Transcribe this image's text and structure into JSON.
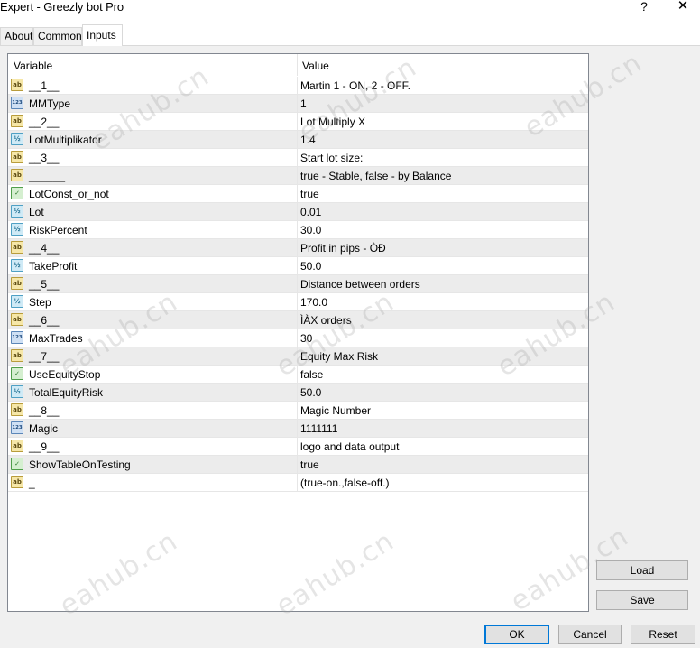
{
  "window": {
    "title": "Expert - Greezly bot Pro",
    "help_label": "?",
    "close_label": "✕"
  },
  "tabs": [
    {
      "label": "About",
      "active": false
    },
    {
      "label": "Common",
      "active": false
    },
    {
      "label": "Inputs",
      "active": true
    }
  ],
  "grid": {
    "col_variable": "Variable",
    "col_value": "Value",
    "rows": [
      {
        "icon": "ab",
        "name": "__1__",
        "value": "Martin 1 - ON, 2 - OFF."
      },
      {
        "icon": "123",
        "name": "MMType",
        "value": "1"
      },
      {
        "icon": "ab",
        "name": "__2__",
        "value": "Lot Multiply X"
      },
      {
        "icon": "1/2",
        "name": "LotMultiplikator",
        "value": "1.4"
      },
      {
        "icon": "ab",
        "name": "__3__",
        "value": "Start lot size:"
      },
      {
        "icon": "ab",
        "name": "______",
        "value": "true - Stable, false - by Balance"
      },
      {
        "icon": "bool",
        "name": "LotConst_or_not",
        "value": "true"
      },
      {
        "icon": "1/2",
        "name": "Lot",
        "value": "0.01"
      },
      {
        "icon": "1/2",
        "name": "RiskPercent",
        "value": "30.0"
      },
      {
        "icon": "ab",
        "name": "__4__",
        "value": "Profit in pips - ÒÐ"
      },
      {
        "icon": "1/2",
        "name": "TakeProfit",
        "value": "50.0"
      },
      {
        "icon": "ab",
        "name": "__5__",
        "value": "Distance between orders"
      },
      {
        "icon": "1/2",
        "name": "Step",
        "value": "170.0"
      },
      {
        "icon": "ab",
        "name": "__6__",
        "value": "ÌÀX orders"
      },
      {
        "icon": "123",
        "name": "MaxTrades",
        "value": "30"
      },
      {
        "icon": "ab",
        "name": "__7__",
        "value": "Equity Max Risk"
      },
      {
        "icon": "bool",
        "name": "UseEquityStop",
        "value": "false"
      },
      {
        "icon": "1/2",
        "name": "TotalEquityRisk",
        "value": "50.0"
      },
      {
        "icon": "ab",
        "name": "__8__",
        "value": "Magic Number"
      },
      {
        "icon": "123",
        "name": "Magic",
        "value": "1111111"
      },
      {
        "icon": "ab",
        "name": "__9__",
        "value": "logo and data output"
      },
      {
        "icon": "bool",
        "name": "ShowTableOnTesting",
        "value": "true"
      },
      {
        "icon": "ab",
        "name": "_",
        "value": "(true-on.,false-off.)"
      }
    ]
  },
  "buttons": {
    "load": "Load",
    "save": "Save",
    "ok": "OK",
    "cancel": "Cancel",
    "reset": "Reset"
  },
  "watermark": "eahub.cn",
  "colors": {
    "default_button_border": "#0078d7",
    "alt_row": "#ececec",
    "panel": "#f0f0f0"
  }
}
